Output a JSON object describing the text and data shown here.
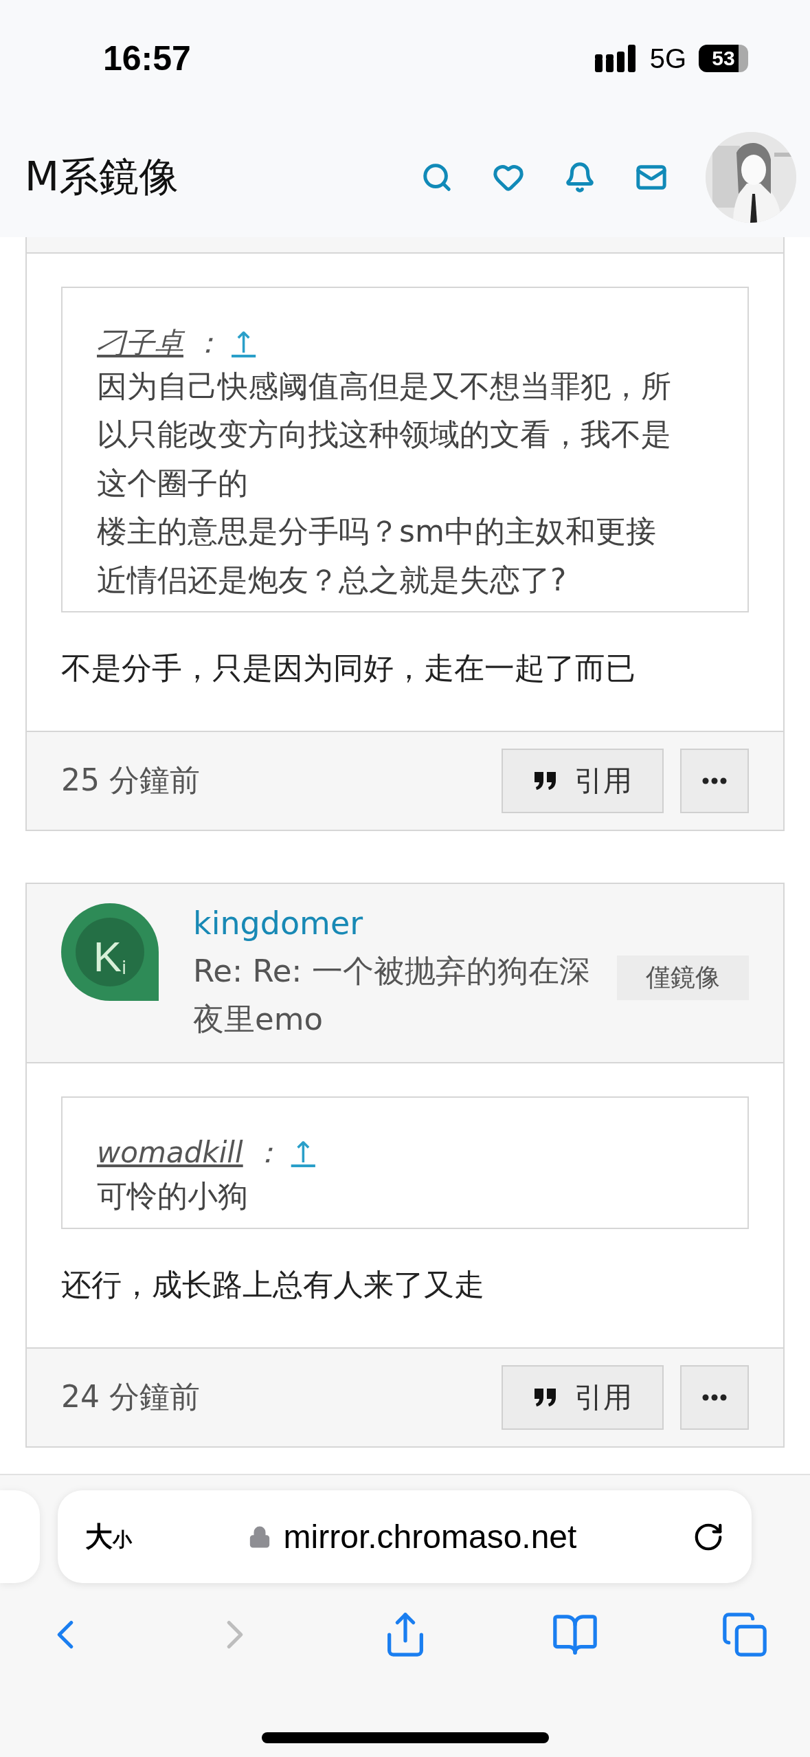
{
  "status_bar": {
    "time": "16:57",
    "network": "5G",
    "battery": "53"
  },
  "header": {
    "title": "M系鏡像"
  },
  "posts": [
    {
      "quote": {
        "author": "刁子卓",
        "separator": "：",
        "link": "↑",
        "paragraphs": [
          "因为自己快感阈值高但是又不想当罪犯，所以只能改变方向找这种领域的文看，我不是这个圈子的",
          "楼主的意思是分手吗？sm中的主奴和更接近情侣还是炮友？总之就是失恋了?"
        ]
      },
      "reply": "不是分手，只是因为同好，走在一起了而已",
      "time": "25 分鐘前",
      "quote_button": "引用"
    },
    {
      "author": {
        "name": "kingdomer",
        "avatar_letter": "K",
        "avatar_sub": "i",
        "color": "#2e8b57"
      },
      "title": "Re: Re: 一个被抛弃的狗在深夜里emo",
      "badge": "僅鏡像",
      "quote": {
        "author": "womadkill",
        "separator": "：",
        "link": "↑",
        "paragraphs": [
          "可怜的小狗"
        ]
      },
      "reply": "还行，成长路上总有人来了又走",
      "time": "24 分鐘前",
      "quote_button": "引用"
    }
  ],
  "browser": {
    "text_size": {
      "large": "大",
      "small": "小"
    },
    "url": "mirror.chromaso.net",
    "nav": [
      {
        "kind": "back",
        "disabled": false
      },
      {
        "kind": "forward",
        "disabled": true
      },
      {
        "kind": "share",
        "disabled": false
      },
      {
        "kind": "bookmarks",
        "disabled": false
      },
      {
        "kind": "tabs",
        "disabled": false
      }
    ]
  }
}
